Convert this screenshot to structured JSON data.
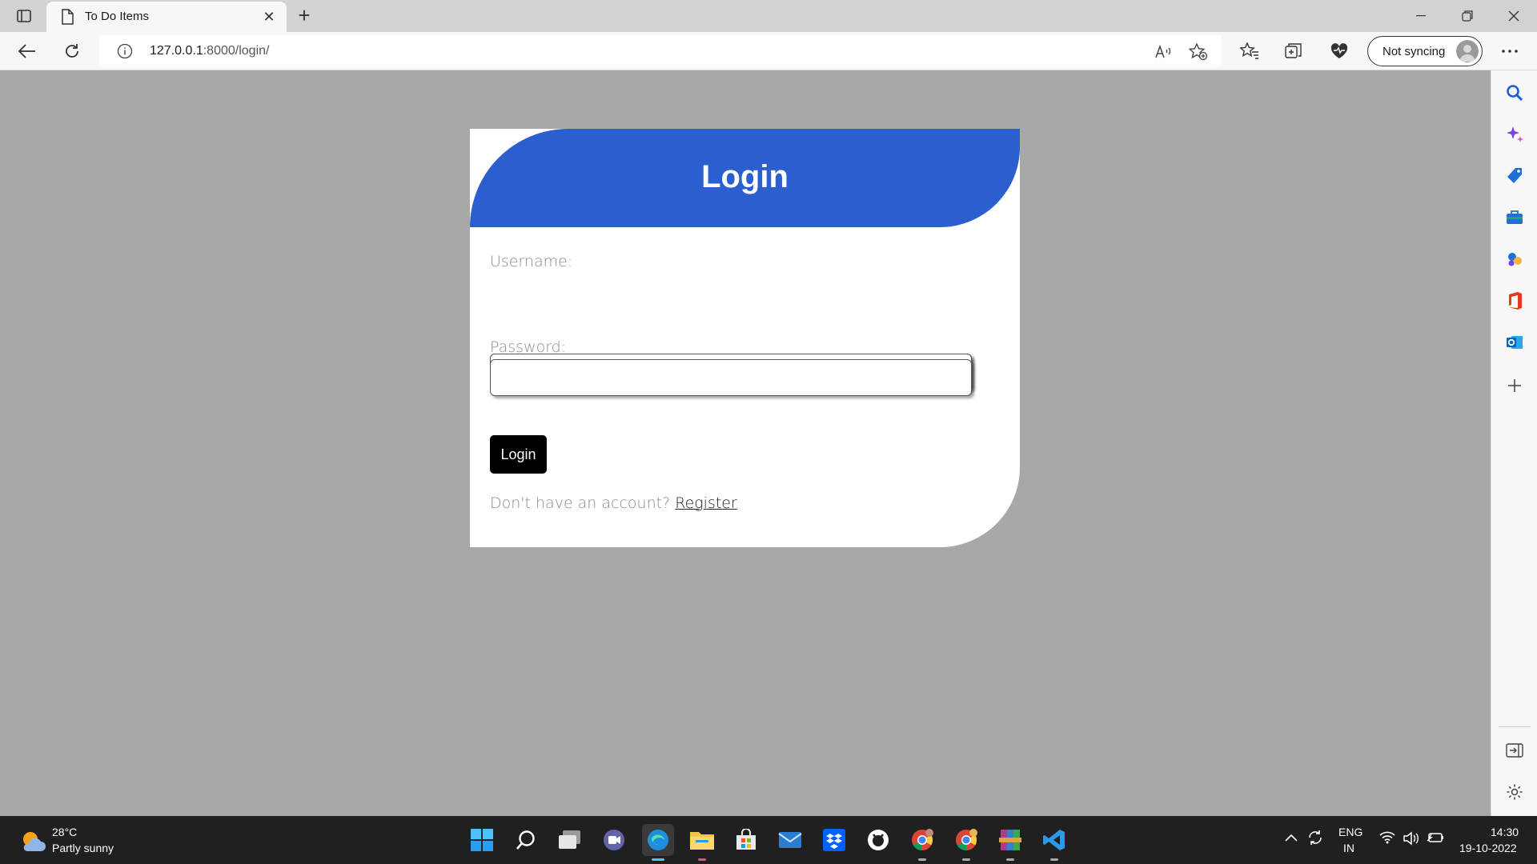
{
  "browser": {
    "tab_title": "To Do Items",
    "url_host": "127.0.0.1",
    "url_path": ":8000/login/",
    "sync_label": "Not syncing"
  },
  "login": {
    "title": "Login",
    "username_label": "Username:",
    "password_label": "Password:",
    "username_value": "",
    "password_value": "",
    "submit_label": "Login",
    "register_prompt": "Don't have an account?",
    "register_link": "Register"
  },
  "colors": {
    "header_blue": "#2b5fd0",
    "page_bg": "#a9a8a9",
    "button_bg": "#000000"
  },
  "taskbar": {
    "weather_temp": "28°C",
    "weather_desc": "Partly sunny",
    "lang_top": "ENG",
    "lang_bottom": "IN",
    "time": "14:30",
    "date": "19-10-2022"
  }
}
